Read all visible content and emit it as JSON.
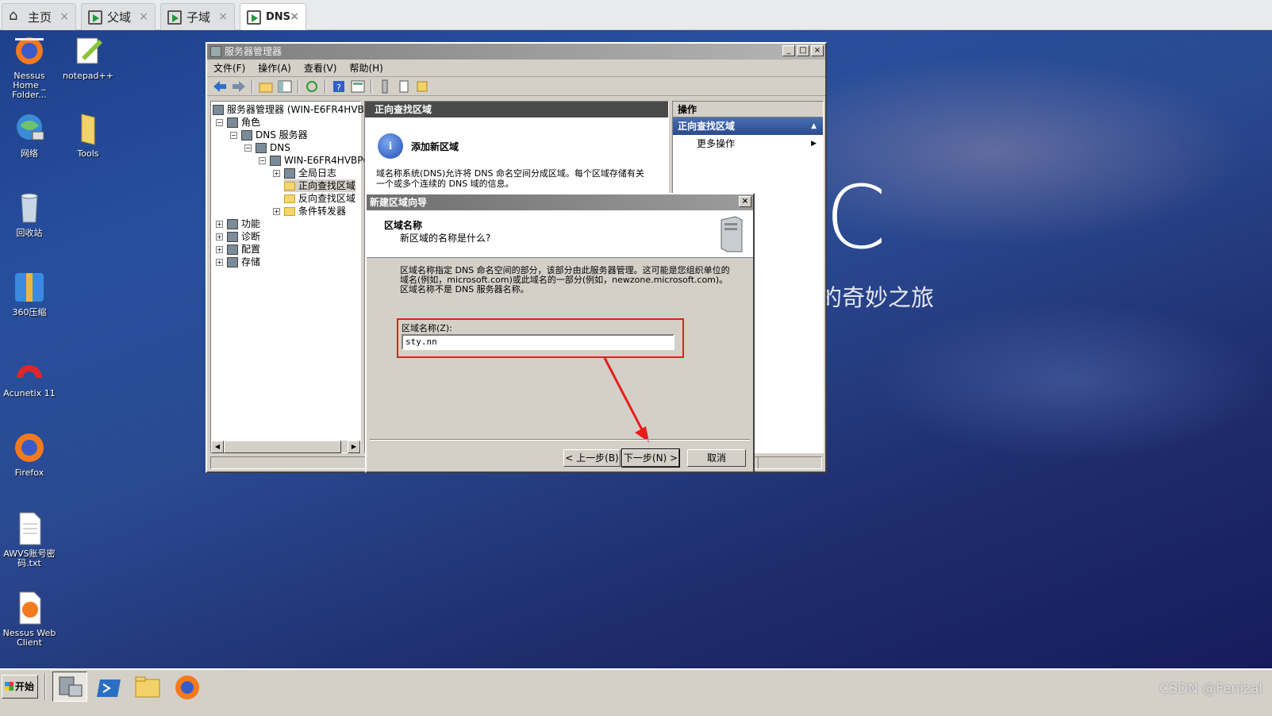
{
  "browser_tabs": [
    {
      "label": "主页",
      "close": "×"
    },
    {
      "label": "父域",
      "close": "×"
    },
    {
      "label": "子域",
      "close": "×"
    },
    {
      "label": "DNS",
      "close": "×"
    }
  ],
  "desktop": {
    "icons": [
      {
        "label": "Nessus Home _ Folder..."
      },
      {
        "label": "notepad++"
      },
      {
        "label": "网络"
      },
      {
        "label": "Tools"
      },
      {
        "label": "回收站"
      },
      {
        "label": "360压缩"
      },
      {
        "label": "Acunetix 11"
      },
      {
        "label": "Firefox"
      },
      {
        "label": "AWVS账号密码.txt"
      },
      {
        "label": "Nessus Web Client"
      }
    ],
    "wallpaper_text": "的奇妙之旅",
    "wallpaper_letter": "C"
  },
  "server_manager": {
    "title": "服务器管理器",
    "menu": [
      "文件(F)",
      "操作(A)",
      "查看(V)",
      "帮助(H)"
    ],
    "tree": {
      "root": "服务器管理器 (WIN-E6FR4HVBPC",
      "roles": "角色",
      "dns_server": "DNS 服务器",
      "dns": "DNS",
      "host": "WIN-E6FR4HVBPCI",
      "global_log": "全局日志",
      "forward_zone": "正向查找区域",
      "reverse_zone": "反向查找区域",
      "conditional_forwarders": "条件转发器",
      "features": "功能",
      "diagnostics": "诊断",
      "configuration": "配置",
      "storage": "存储"
    },
    "center": {
      "header": "正向查找区域",
      "add_zone_title": "添加新区域",
      "add_zone_desc": "域名称系统(DNS)允许将 DNS 命名空间分成区域。每个区域存储有关一个或多个连续的 DNS 域的信息。"
    },
    "actions": {
      "header": "操作",
      "section": "正向查找区域",
      "more": "更多操作"
    }
  },
  "wizard": {
    "title": "新建区域向导",
    "close": "×",
    "section_title": "区域名称",
    "section_subtitle": "新区域的名称是什么?",
    "explanation": "区域名称指定 DNS 命名空间的部分，该部分由此服务器管理。这可能是您组织单位的域名(例如，microsoft.com)或此域名的一部分(例如，newzone.microsoft.com)。区域名称不是 DNS 服务器名称。",
    "field_label": "区域名称(Z):",
    "field_value": "sty.nn",
    "back_button": "< 上一步(B)",
    "next_button": "下一步(N) >",
    "cancel_button": "取消"
  },
  "taskbar": {
    "start_label": "开始",
    "watermark": "CSDN @Fenizal"
  },
  "colors": {
    "highlight_box": "#e81c1c",
    "action_header": "#2a4a8e"
  }
}
